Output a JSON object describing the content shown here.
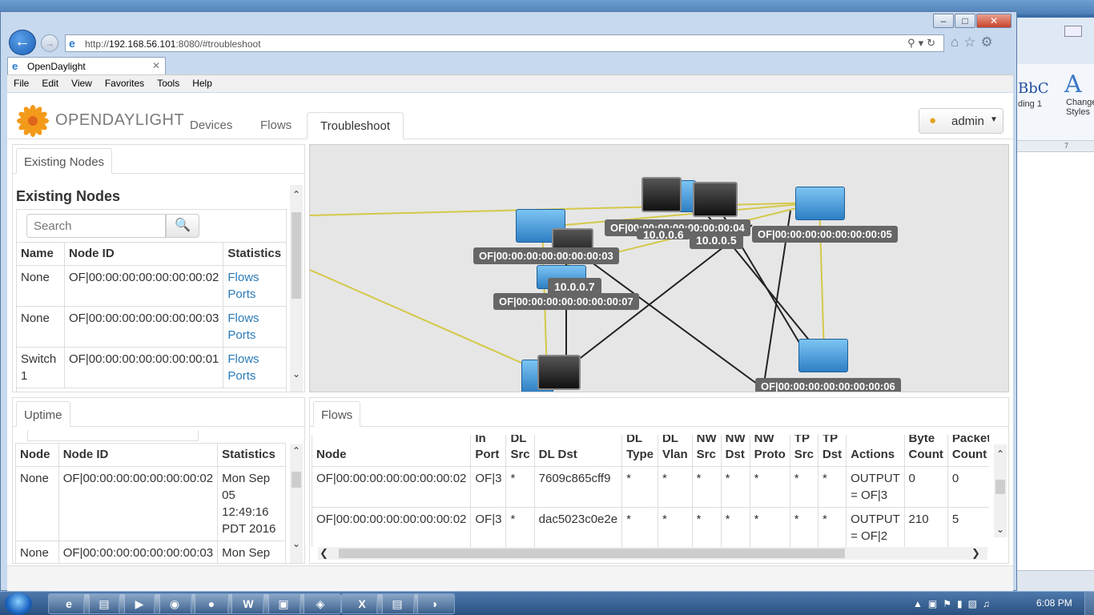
{
  "browser": {
    "url_host": "192.168.56.101",
    "url_prefix": "http://",
    "url_suffix": ":8080/#troubleshoot",
    "tab_title": "OpenDaylight",
    "menu": [
      "File",
      "Edit",
      "View",
      "Favorites",
      "Tools",
      "Help"
    ]
  },
  "app": {
    "logo_text": "OPENDAYLIGHT",
    "nav": [
      "Devices",
      "Flows",
      "Troubleshoot"
    ],
    "active_nav": "Troubleshoot",
    "user": "admin"
  },
  "existing_nodes": {
    "tab": "Existing Nodes",
    "heading": "Existing Nodes",
    "search_placeholder": "Search",
    "columns": [
      "Name",
      "Node ID",
      "Statistics"
    ],
    "rows": [
      {
        "name": "None",
        "node_id": "OF|00:00:00:00:00:00:00:02",
        "flows": "Flows",
        "ports": "Ports"
      },
      {
        "name": "None",
        "node_id": "OF|00:00:00:00:00:00:00:03",
        "flows": "Flows",
        "ports": "Ports"
      },
      {
        "name": "Switch 1",
        "node_id": "OF|00:00:00:00:00:00:00:01",
        "flows": "Flows",
        "ports": "Ports"
      }
    ]
  },
  "uptime": {
    "tab": "Uptime",
    "columns": [
      "Node",
      "Node ID",
      "Statistics"
    ],
    "rows": [
      {
        "node": "None",
        "node_id": "OF|00:00:00:00:00:00:00:02",
        "stat": "Mon Sep 05 12:49:16 PDT 2016"
      },
      {
        "node": "None",
        "node_id": "OF|00:00:00:00:00:00:00:03",
        "stat": "Mon Sep"
      }
    ]
  },
  "topology": {
    "switches": [
      {
        "id": "OF|00:00:00:00:00:00:00:03"
      },
      {
        "id": "OF|00:00:00:00:00:00:00:04"
      },
      {
        "id": "OF|00:00:00:00:00:00:00:05"
      },
      {
        "id": "OF|00:00:00:00:00:00:00:07"
      },
      {
        "id": "OF|00:00:00:00:00:00:00:06"
      }
    ],
    "hosts": [
      "10.0.0.7",
      "10.0.0.5",
      "10.0.0.6"
    ]
  },
  "flows": {
    "tab": "Flows",
    "columns": [
      "Node",
      "In Port",
      "DL Src",
      "DL Dst",
      "DL Type",
      "DL Vlan",
      "NW Src",
      "NW Dst",
      "NW Proto",
      "TP Src",
      "TP Dst",
      "Actions",
      "Byte Count",
      "Packet Count"
    ],
    "rows": [
      [
        "OF|00:00:00:00:00:00:00:02",
        "OF|3",
        "*",
        "7609c865cff9",
        "*",
        "*",
        "*",
        "*",
        "*",
        "*",
        "*",
        "OUTPUT = OF|3",
        "0",
        "0"
      ],
      [
        "OF|00:00:00:00:00:00:00:02",
        "OF|3",
        "*",
        "dac5023c0e2e",
        "*",
        "*",
        "*",
        "*",
        "*",
        "*",
        "*",
        "OUTPUT = OF|2",
        "210",
        "5"
      ]
    ]
  },
  "word": {
    "style_sample": "BbC",
    "style_label": "ding 1",
    "change_styles": "Change Styles",
    "ruler_mark": "7"
  },
  "taskbar": {
    "clock": "6:08 PM"
  }
}
